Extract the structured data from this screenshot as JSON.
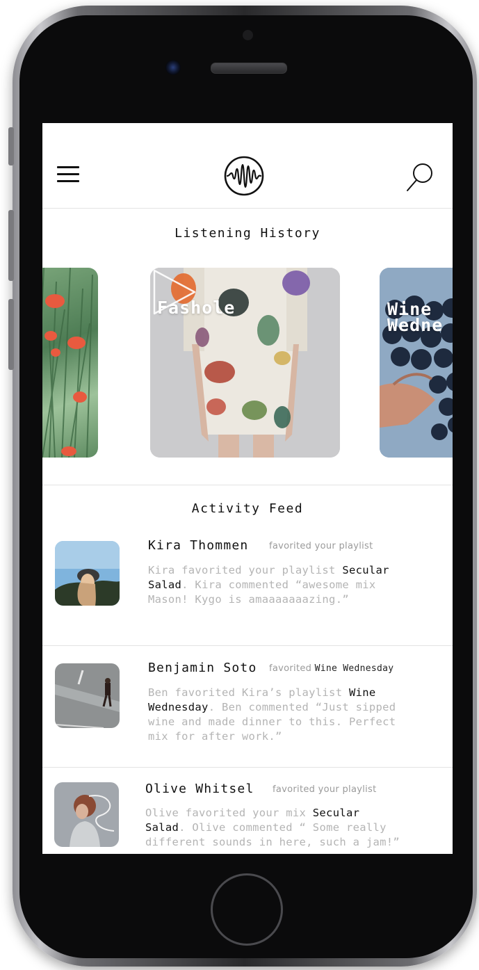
{
  "header": {
    "menu_icon": "hamburger-menu-icon",
    "logo_icon": "soundwave-logo-icon",
    "search_icon": "search-icon"
  },
  "listening_history": {
    "title": "Listening History",
    "cards": [
      {
        "title": "",
        "image": "poppy-field-photo"
      },
      {
        "title": "Fashole",
        "image": "floral-dress-photo",
        "overlay_icon": "play-icon"
      },
      {
        "title": "Wine\nWedne",
        "image": "grapes-in-hand-photo"
      }
    ]
  },
  "activity_feed": {
    "title": "Activity Feed",
    "items": [
      {
        "name": "Kira Thommen",
        "action": "favorited your playlist",
        "action_target": "",
        "body_pre": "Kira favorited your playlist ",
        "body_highlight": "Secular Salad",
        "body_post": ". Kira commented “awesome mix Mason! Kygo is amaaaaaaazing.”"
      },
      {
        "name": "Benjamin Soto",
        "action": "favorited",
        "action_target": "Wine Wednesday",
        "body_pre": "Ben favorited Kira’s playlist ",
        "body_highlight": "Wine Wednesday",
        "body_post": ". Ben commented “Just sipped wine and made dinner to this. Perfect mix for after work.”"
      },
      {
        "name": "Olive Whitsel",
        "action": "favorited your playlist",
        "action_target": "",
        "body_pre": "Olive favorited your mix ",
        "body_highlight": "Secular Salad",
        "body_post": ". Olive commented “ Some really different sounds in here, such a jam!”"
      }
    ]
  },
  "colors": {
    "text_primary": "#111111",
    "text_muted": "#b4b4b4",
    "divider": "#e3e3e3",
    "phone_body": "#0b0b0c"
  }
}
